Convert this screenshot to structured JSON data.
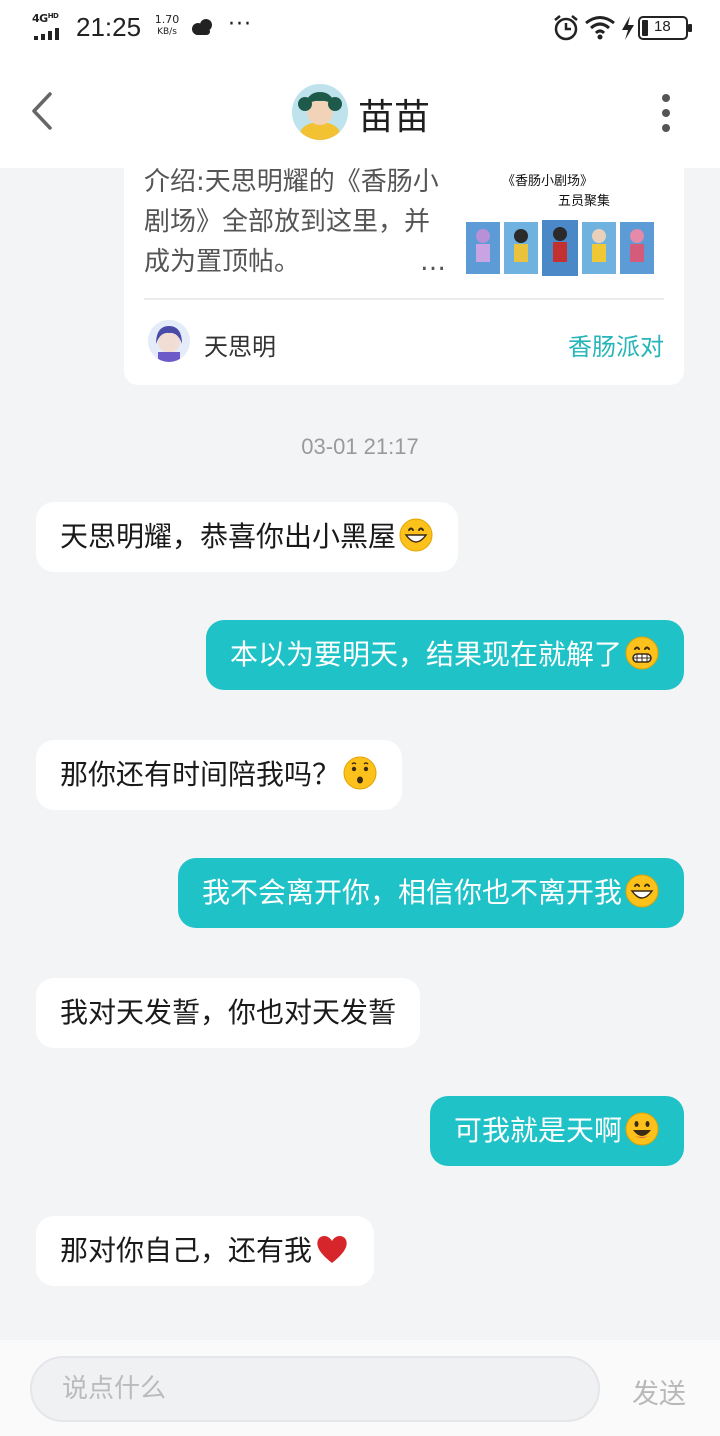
{
  "status_bar": {
    "network": "4G",
    "network_sup": "HD",
    "time": "21:25",
    "speed_value": "1.70",
    "speed_unit": "KB/s",
    "more": "···",
    "battery": "18",
    "icons": [
      "signal-icon",
      "cloud-icon",
      "alarm-icon",
      "wifi-icon",
      "charging-icon",
      "battery-icon"
    ]
  },
  "header": {
    "title": "苗苗",
    "back_icon": "chevron-left-icon",
    "more_icon": "more-vertical-icon"
  },
  "shared_card": {
    "intro": "介绍:天思明耀的《香肠小剧场》全部放到这里，并成为置顶帖。",
    "ellipsis": "…",
    "thumbnail_title": "《香肠小剧场》",
    "thumbnail_subtitle": "五员聚集",
    "author": "天思明",
    "source": "香肠派对"
  },
  "timestamp": "03-01 21:17",
  "messages": [
    {
      "side": "in",
      "text": "天思明耀，恭喜你出小黑屋",
      "emoji": "grinning-emoji"
    },
    {
      "side": "out",
      "text": "本以为要明天，结果现在就解了",
      "emoji": "grin-emoji"
    },
    {
      "side": "in",
      "text": "那你还有时间陪我吗？",
      "emoji": "kissing-emoji"
    },
    {
      "side": "out",
      "text": "我不会离开你，相信你也不离开我",
      "emoji": "grinning-emoji"
    },
    {
      "side": "in",
      "text": "我对天发誓，你也对天发誓",
      "emoji": ""
    },
    {
      "side": "out",
      "text": "可我就是天啊",
      "emoji": "smiley-emoji"
    },
    {
      "side": "in",
      "text": "那对你自己，还有我",
      "emoji": "heart-emoji"
    }
  ],
  "input": {
    "placeholder": "说点什么",
    "send_label": "发送"
  },
  "colors": {
    "accent": "#1fc2c7",
    "link": "#26b5b8",
    "background": "#f3f4f6"
  }
}
